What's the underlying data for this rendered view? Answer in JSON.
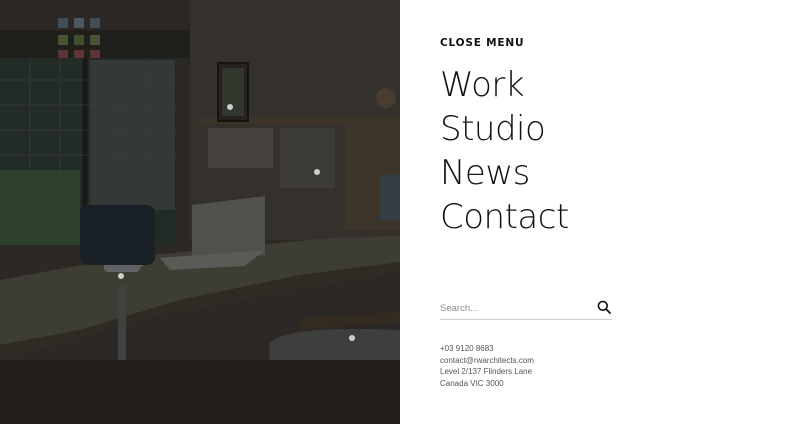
{
  "menu": {
    "close_label": "CLOSE MENU",
    "nav_items": [
      "Work",
      "Studio",
      "News",
      "Contact"
    ]
  },
  "search": {
    "placeholder": "Search...",
    "icon": "search-icon"
  },
  "contact": {
    "phone": "+03 9120 8683",
    "email": "contact@rwarchitects.com",
    "address_line1": "Level 2/137 Flinders Lane",
    "address_line2": "Canada VIC 3000"
  },
  "photo": {
    "subject": "architect studio office interior",
    "overlay_color": "#000000"
  },
  "colors": {
    "menu_bg": "#ffffff",
    "text": "#111111",
    "muted": "#555555"
  }
}
